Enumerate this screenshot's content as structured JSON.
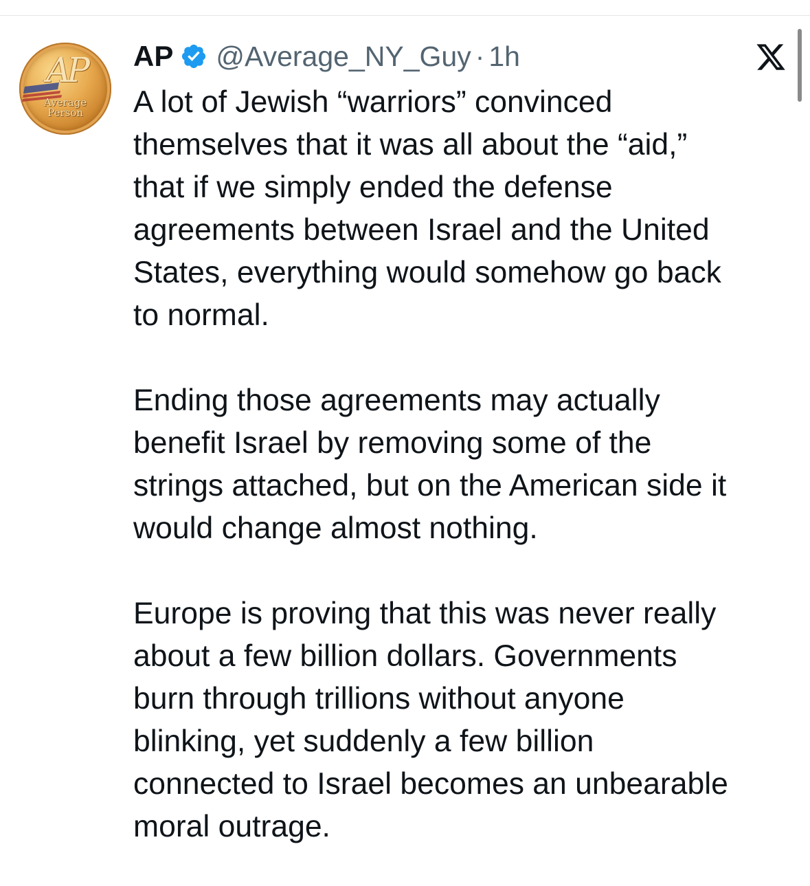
{
  "avatar": {
    "logo_text": "AP",
    "caption_line1": "Average",
    "caption_line2": "Person",
    "gold_color": "#e2a452"
  },
  "author": {
    "display_name": "AP",
    "verified": true,
    "verified_color": "#1d9bf0",
    "handle": "@Average_NY_Guy",
    "separator": "·",
    "time_ago": "1h"
  },
  "brand_icon": "x-logo-icon",
  "tweet": {
    "paragraphs": [
      [
        "A lot of Jewish “warriors” convinced",
        "themselves that it was all about the “aid,”",
        "that if we simply ended the defense",
        "agreements between Israel and the United",
        "States, everything would somehow go back",
        "to normal."
      ],
      [
        "Ending those agreements may actually",
        "benefit Israel by removing some of the",
        "strings attached, but on the American side it",
        "would change almost nothing."
      ],
      [
        "Europe is proving that this was never really",
        "about a few billion dollars. Governments",
        "burn through trillions without anyone",
        "blinking, yet suddenly a few billion",
        "connected to Israel becomes an unbearable",
        "moral outrage."
      ]
    ]
  }
}
